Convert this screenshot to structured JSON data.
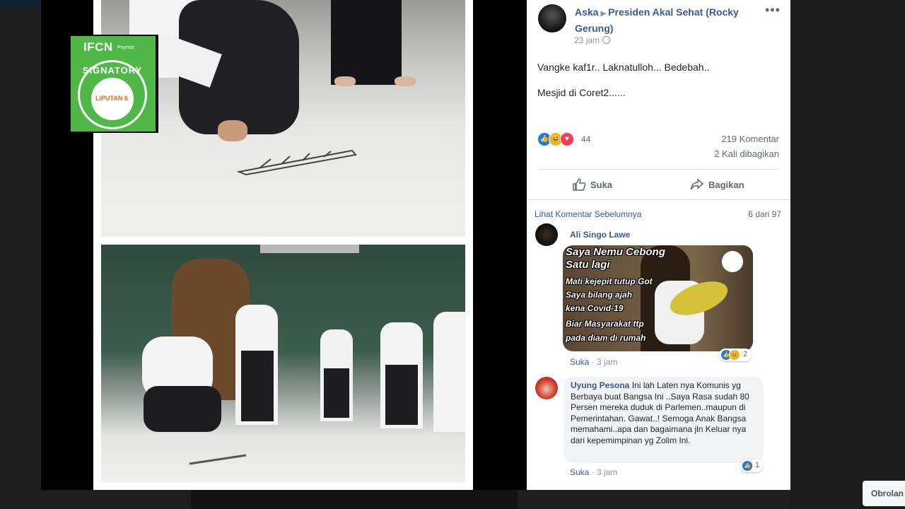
{
  "post": {
    "author": "Aska",
    "group": "Presiden Akal Sehat (Rocky Gerung)",
    "time": "23 jam",
    "text_line1": "Vangke kaf1r.. Laknatulloh... Bedebah..",
    "text_line2": "Mesjid di Coret2......",
    "reaction_count": "44",
    "comment_count": "219 Komentar",
    "share_count": "2 Kali dibagikan",
    "like_label": "Suka",
    "share_label": "Bagikan"
  },
  "comments_header": {
    "more_link": "Lihat Komentar Sebelumnya",
    "count": "6 dari 97"
  },
  "comments": [
    {
      "name": "Ali Singo Lawe",
      "meme_lines": [
        "Saya Nemu Cebong",
        "Satu lagi",
        "Mati kejepit tutup Got",
        "Saya bilang ajah",
        "kena Covid-19",
        "Biar Masyarakat ttp",
        "pada diam di rumah"
      ],
      "reaction_count": "2",
      "like_label": "Suka",
      "time": "3 jam"
    },
    {
      "name": "Uyung Pesona",
      "text": "Ini lah Laten nya Komunis yg Berbaya buat Bangsa Ini ..Saya Rasa sudah 80 Persen mereka duduk di Parlemen..maupun di Pemerintahan. Gawat..! Semoga Anak Bangsa memahami..apa dan bagaimana jln Keluar nya dari kepemimpinan yg Zolim Ini.",
      "reaction_count": "1",
      "like_label": "Suka",
      "time": "3 jam"
    }
  ],
  "badge": {
    "title": "IFCN",
    "subtitle": "Poynter",
    "ring": "SIGNATORY",
    "logo": "LIPUTAN 6"
  },
  "chat": {
    "label": "Obrolan"
  },
  "colors": {
    "link": "#385898",
    "like_blue": "#1877f2",
    "haha_yellow": "#f7b125",
    "love_red": "#f33e58",
    "badge_green": "#4fb847"
  }
}
